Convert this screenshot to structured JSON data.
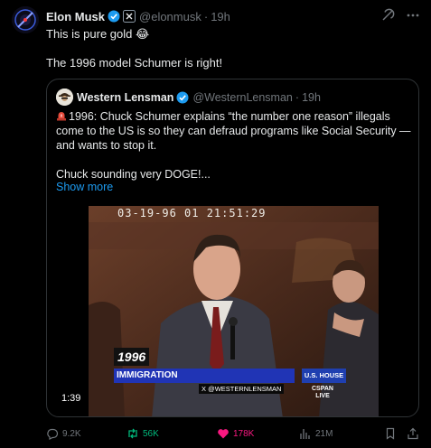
{
  "post": {
    "author_name": "Elon Musk",
    "author_handle": "@elonmusk",
    "time": "19h",
    "separator": "·",
    "line1": "This is pure gold 😂",
    "line2": "The 1996 model Schumer is right!"
  },
  "quote": {
    "author_name": "Western Lensman",
    "author_handle": "@WesternLensman",
    "time": "19h",
    "separator": "·",
    "line1": "1996: Chuck Schumer explains “the number one reason” illegals",
    "line2": "come to the US is so they can defraud programs like Social Security —",
    "line3": "and wants to stop it.",
    "line4": "Chuck sounding very DOGE!...",
    "show_more": "Show more"
  },
  "video": {
    "timestamp": "03-19-96  01  21:51:29",
    "year_tag": "1996",
    "chyron": "IMMIGRATION",
    "watermark": "X @WESTERNLENSMAN",
    "house_label": "U.S. HOUSE",
    "cspan_line1": "CSPAN",
    "cspan_line2": "LIVE",
    "duration": "1:39"
  },
  "actions": {
    "replies": "9.2K",
    "reposts": "56K",
    "likes": "178K",
    "views": "21M"
  },
  "colors": {
    "background": "#000000",
    "text": "#e7e9ea",
    "muted": "#71767b",
    "link": "#1d9bf0",
    "verified": "#1d9bf0",
    "repost": "#00ba7c",
    "like": "#f91880",
    "border": "#2f3336"
  },
  "icons": [
    "grok-icon",
    "more-icon",
    "verified-badge-icon",
    "x-affiliate-badge-icon",
    "siren-icon",
    "reply-icon",
    "repost-icon",
    "heart-icon",
    "views-icon",
    "bookmark-icon",
    "share-icon"
  ]
}
